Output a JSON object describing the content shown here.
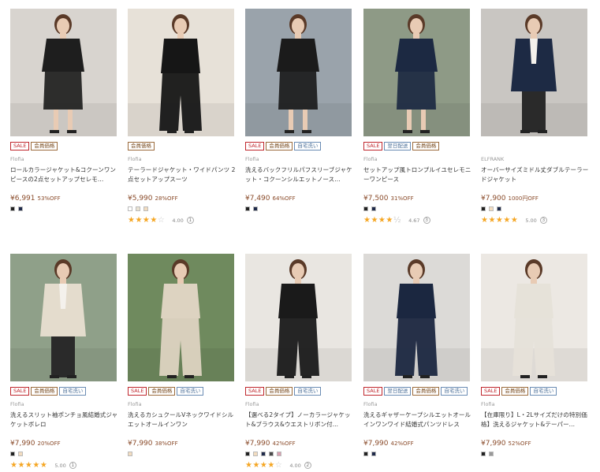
{
  "products": [
    {
      "badges": [
        {
          "type": "sale",
          "label": "SALE"
        },
        {
          "type": "member",
          "label": "会員価格"
        }
      ],
      "brand": "Flofia",
      "title": "ロールカラージャケット&コクーンワンピースの2点セットアップセレモ...",
      "price": "¥6,991",
      "off": "53%OFF",
      "swatches": [
        "#222222",
        "#1f2a4a"
      ],
      "rating": null,
      "image": {
        "bg": "#d8d4cf",
        "outfit": "#1e1e1e",
        "skin": "#e8cbb4",
        "type": "dress"
      }
    },
    {
      "badges": [
        {
          "type": "member",
          "label": "会員価格"
        }
      ],
      "brand": "Flofia",
      "title": "テーラードジャケット・ワイドパンツ 2点セットアップスーツ",
      "price": "¥5,990",
      "off": "28%OFF",
      "swatches": [
        "#ffffff",
        "#e9e2d2",
        "#f2dcc0"
      ],
      "rating": {
        "stars": "★★★★",
        "empty": "☆",
        "score": "4.00",
        "count": "1"
      },
      "image": {
        "bg": "#e7e1d8",
        "outfit": "#161616",
        "skin": "#e8cbb4",
        "type": "pants"
      }
    },
    {
      "badges": [
        {
          "type": "sale",
          "label": "SALE"
        },
        {
          "type": "member",
          "label": "会員価格"
        },
        {
          "type": "wash",
          "label": "自宅洗い"
        }
      ],
      "brand": "Flofia",
      "title": "洗えるバックフリルパフスリーブジャケット・コクーンシルエットノース...",
      "price": "¥7,490",
      "off": "64%OFF",
      "swatches": [
        "#222222",
        "#1f2a4a"
      ],
      "rating": null,
      "image": {
        "bg": "#9aa3ab",
        "outfit": "#1b1b1b",
        "skin": "#e8cbb4",
        "type": "dress"
      }
    },
    {
      "badges": [
        {
          "type": "sale",
          "label": "SALE"
        },
        {
          "type": "ship",
          "label": "翌日配送"
        },
        {
          "type": "member",
          "label": "会員価格"
        }
      ],
      "brand": "Flofia",
      "title": "セットアップ風トロンプルイユセレモニーワンピース",
      "price": "¥7,500",
      "off": "31%OFF",
      "swatches": [
        "#222222",
        "#1f2a4a"
      ],
      "rating": {
        "stars": "★★★★",
        "empty": "½",
        "score": "4.67",
        "count": "3"
      },
      "image": {
        "bg": "#8e9a86",
        "outfit": "#1c2942",
        "skin": "#e8cbb4",
        "type": "dress"
      }
    },
    {
      "badges": [],
      "brand": "ELFRANK",
      "title": "オーバーサイズミドル丈ダブルテーラードジャケット",
      "price": "¥7,900",
      "off": "1000円OFF",
      "swatches": [
        "#222222",
        "#f2dcc0",
        "#1f2a4a"
      ],
      "rating": {
        "stars": "★★★★★",
        "empty": "",
        "score": "5.00",
        "count": "3"
      },
      "image": {
        "bg": "#c9c6c2",
        "outfit": "#1d2a44",
        "skin": "#e8cbb4",
        "type": "jacket"
      }
    },
    {
      "badges": [
        {
          "type": "sale",
          "label": "SALE"
        },
        {
          "type": "member",
          "label": "会員価格"
        },
        {
          "type": "wash",
          "label": "自宅洗い"
        }
      ],
      "brand": "Flofia",
      "title": "洗えるスリット袖ポンチョ風結婚式ジャケットボレロ",
      "price": "¥7,990",
      "off": "20%OFF",
      "swatches": [
        "#222222",
        "#f2dcc0"
      ],
      "rating": {
        "stars": "★★★★★",
        "empty": "",
        "score": "5.00",
        "count": "1"
      },
      "image": {
        "bg": "#8fa089",
        "outfit": "#e4dccd",
        "skin": "#e8cbb4",
        "type": "jacket"
      }
    },
    {
      "badges": [
        {
          "type": "sale",
          "label": "SALE"
        },
        {
          "type": "member",
          "label": "会員価格"
        },
        {
          "type": "wash",
          "label": "自宅洗い"
        }
      ],
      "brand": "Flofia",
      "title": "洗えるカシュクールVネックワイドシルエットオールインワン",
      "price": "¥7,990",
      "off": "38%OFF",
      "swatches": [
        "#f2dcc0"
      ],
      "rating": null,
      "image": {
        "bg": "#6f8a5e",
        "outfit": "#ddd3c1",
        "skin": "#e8cbb4",
        "type": "pants"
      }
    },
    {
      "badges": [
        {
          "type": "sale",
          "label": "SALE"
        },
        {
          "type": "member",
          "label": "会員価格"
        },
        {
          "type": "wash",
          "label": "自宅洗い"
        }
      ],
      "brand": "Flofia",
      "title": "【選べる2タイプ】ノーカラージャケット&ブラウス&ウエストリボン付...",
      "price": "¥7,990",
      "off": "42%OFF",
      "swatches": [
        "#222222",
        "#f2dcc0",
        "#1f2a4a",
        "#4a4a4a",
        "#d9a0b0"
      ],
      "rating": {
        "stars": "★★★★",
        "empty": "☆",
        "score": "4.00",
        "count": "2"
      },
      "image": {
        "bg": "#e9e6e1",
        "outfit": "#1a1a1a",
        "skin": "#e8cbb4",
        "type": "pants"
      }
    },
    {
      "badges": [
        {
          "type": "sale",
          "label": "SALE"
        },
        {
          "type": "ship",
          "label": "翌日配送"
        },
        {
          "type": "member",
          "label": "会員価格"
        },
        {
          "type": "wash",
          "label": "自宅洗い"
        }
      ],
      "brand": "Flofia",
      "title": "洗えるギャザーケープシルエットオールインワンワイド結婚式パンツドレス",
      "price": "¥7,990",
      "off": "42%OFF",
      "swatches": [
        "#222222",
        "#1f2a4a"
      ],
      "rating": null,
      "image": {
        "bg": "#dcdad7",
        "outfit": "#1b2740",
        "skin": "#e8cbb4",
        "type": "pants"
      }
    },
    {
      "badges": [
        {
          "type": "sale",
          "label": "SALE"
        },
        {
          "type": "member",
          "label": "会員価格"
        },
        {
          "type": "wash",
          "label": "自宅洗い"
        }
      ],
      "brand": "Flofia",
      "title": "【在庫限り】L・2Lサイズだけの特別価格】洗えるジャケット&テーパー...",
      "price": "¥7,990",
      "off": "52%OFF",
      "swatches": [
        "#222222",
        "#999999"
      ],
      "rating": null,
      "image": {
        "bg": "#ece8e3",
        "outfit": "#e6e2d9",
        "skin": "#e8cbb4",
        "type": "pants"
      }
    }
  ]
}
